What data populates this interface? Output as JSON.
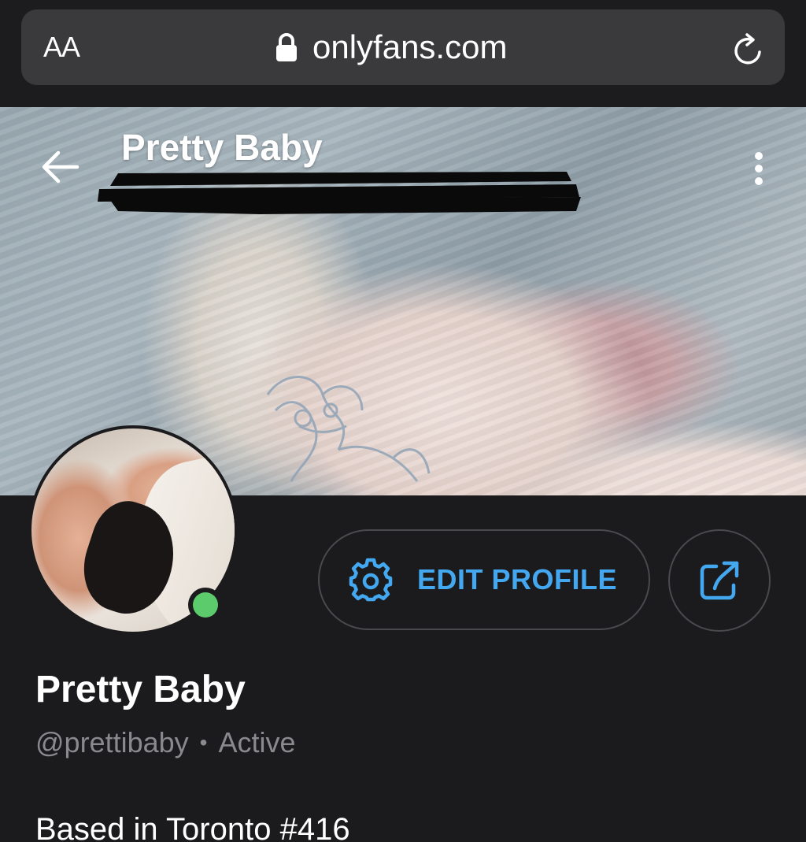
{
  "browser": {
    "text_size_label": "AA",
    "domain": "onlyfans.com"
  },
  "cover": {
    "title": "Pretty Baby"
  },
  "actions": {
    "edit_profile_label": "EDIT PROFILE"
  },
  "profile": {
    "name": "Pretty Baby",
    "handle": "@prettibaby",
    "separator": "•",
    "status": "Active",
    "bio": "Based in Toronto #416"
  },
  "colors": {
    "accent": "#44a8f0",
    "online": "#5ccb6b",
    "background": "#1b1b1d"
  }
}
